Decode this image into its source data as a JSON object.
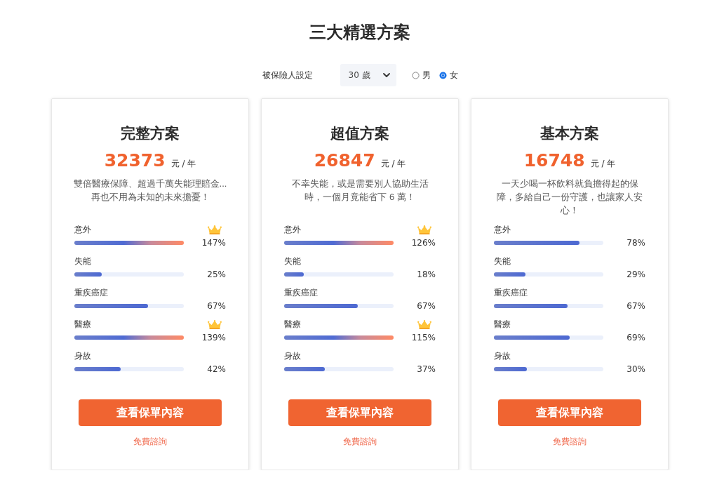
{
  "title": "三大精選方案",
  "settings": {
    "label": "被保險人設定",
    "age_select": {
      "value": "30 歲"
    },
    "genders": [
      {
        "label": "男",
        "selected": false
      },
      {
        "label": "女",
        "selected": true
      }
    ]
  },
  "plans": [
    {
      "name": "完整方案",
      "price": "32373",
      "unit": "元 / 年",
      "description": "雙倍醫療保障、超過千萬失能理賠金...再也不用為未知的未來擔憂！",
      "coverages": [
        {
          "label": "意外",
          "level": 1,
          "reading": "147%",
          "crown": true
        },
        {
          "label": "失能",
          "level": 0.25,
          "reading": "25%",
          "crown": false
        },
        {
          "label": "重疾癌症",
          "level": 0.67,
          "reading": "67%",
          "crown": false
        },
        {
          "label": "醫療",
          "level": 1,
          "reading": "139%",
          "crown": true
        },
        {
          "label": "身故",
          "level": 0.42,
          "reading": "42%",
          "crown": false
        }
      ],
      "button": "查看保單內容",
      "link": "免費諮詢"
    },
    {
      "name": "超值方案",
      "price": "26847",
      "unit": "元 / 年",
      "description": "不幸失能，或是需要別人協助生活時，一個月竟能省下 6 萬！",
      "coverages": [
        {
          "label": "意外",
          "level": 1,
          "reading": "126%",
          "crown": true
        },
        {
          "label": "失能",
          "level": 0.18,
          "reading": "18%",
          "crown": false
        },
        {
          "label": "重疾癌症",
          "level": 0.67,
          "reading": "67%",
          "crown": false
        },
        {
          "label": "醫療",
          "level": 1,
          "reading": "115%",
          "crown": true
        },
        {
          "label": "身故",
          "level": 0.37,
          "reading": "37%",
          "crown": false
        }
      ],
      "button": "查看保單內容",
      "link": "免費諮詢"
    },
    {
      "name": "基本方案",
      "price": "16748",
      "unit": "元 / 年",
      "description": "一天少喝一杯飲料就負擔得起的保障，多給自己一份守護，也讓家人安心！",
      "coverages": [
        {
          "label": "意外",
          "level": 0.78,
          "reading": "78%",
          "crown": false
        },
        {
          "label": "失能",
          "level": 0.29,
          "reading": "29%",
          "crown": false
        },
        {
          "label": "重疾癌症",
          "level": 0.67,
          "reading": "67%",
          "crown": false
        },
        {
          "label": "醫療",
          "level": 0.69,
          "reading": "69%",
          "crown": false
        },
        {
          "label": "身故",
          "level": 0.3,
          "reading": "30%",
          "crown": false
        }
      ],
      "button": "查看保單內容",
      "link": "免費諮詢"
    }
  ]
}
